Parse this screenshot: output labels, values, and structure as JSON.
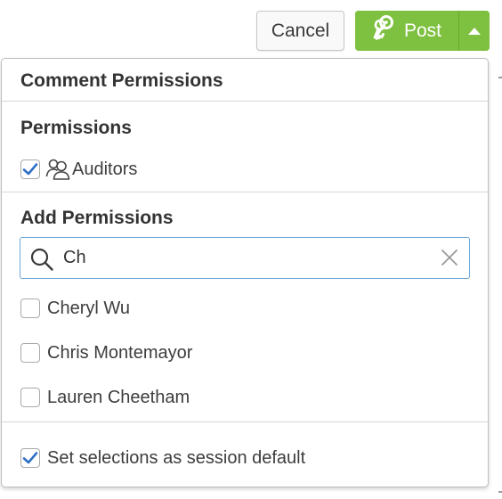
{
  "toolbar": {
    "cancel_label": "Cancel",
    "post_label": "Post",
    "post_color": "#7ec040"
  },
  "panel": {
    "title": "Comment Permissions",
    "permissions": {
      "heading": "Permissions",
      "items": [
        {
          "label": "Auditors",
          "checked": true,
          "icon": "group-icon"
        }
      ]
    },
    "add_permissions": {
      "heading": "Add Permissions",
      "search": {
        "value": "Ch",
        "placeholder": ""
      },
      "results": [
        {
          "label": "Cheryl Wu",
          "checked": false
        },
        {
          "label": "Chris Montemayor",
          "checked": false
        },
        {
          "label": "Lauren Cheetham",
          "checked": false
        }
      ]
    },
    "session_default": {
      "label": "Set selections as session default",
      "checked": true
    }
  },
  "colors": {
    "check": "#2f6fc6",
    "focus_border": "#6aa6d8"
  }
}
